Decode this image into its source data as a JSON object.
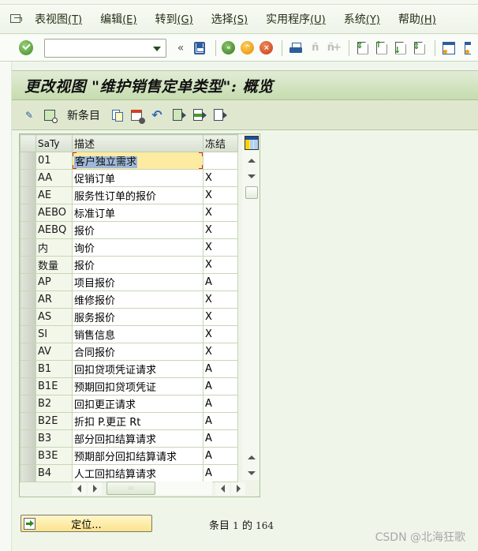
{
  "menubar": {
    "items": [
      {
        "label": "表视图",
        "accel": "(T)"
      },
      {
        "label": "编辑",
        "accel": "(E)"
      },
      {
        "label": "转到",
        "accel": "(G)"
      },
      {
        "label": "选择",
        "accel": "(S)"
      },
      {
        "label": "实用程序",
        "accel": "(U)"
      },
      {
        "label": "系统",
        "accel": "(Y)"
      },
      {
        "label": "帮助",
        "accel": "(H)"
      }
    ]
  },
  "toolbar": {
    "command_field_value": "",
    "history_glyph": "«",
    "icons": [
      "enter-icon",
      "save-icon",
      "back-icon",
      "exit-icon",
      "cancel-icon",
      "print-icon",
      "find-icon",
      "find-next-icon",
      "first-page-icon",
      "previous-page-icon",
      "next-page-icon",
      "last-page-icon",
      "create-session-icon",
      "shortcut-icon"
    ]
  },
  "title": "更改视图 \"维护销售定单类型\": 概览",
  "app_toolbar": {
    "new_entries_label": "新条目",
    "icons": [
      "display-change-icon",
      "details-icon",
      "copy-icon",
      "delete-icon",
      "undo-icon",
      "select-all-icon",
      "select-block-icon",
      "deselect-all-icon"
    ]
  },
  "table": {
    "columns": [
      "SaTy",
      "描述",
      "冻结"
    ],
    "rows": [
      {
        "saty": "01",
        "desc": "客户独立需求",
        "frz": ""
      },
      {
        "saty": "AA",
        "desc": "促销订单",
        "frz": "X"
      },
      {
        "saty": "AE",
        "desc": "服务性订单的报价",
        "frz": "X"
      },
      {
        "saty": "AEBO",
        "desc": "标准订单",
        "frz": "X"
      },
      {
        "saty": "AEBQ",
        "desc": "报价",
        "frz": "X"
      },
      {
        "saty": "内",
        "desc": "询价",
        "frz": "X"
      },
      {
        "saty": "数量",
        "desc": "报价",
        "frz": "X"
      },
      {
        "saty": "AP",
        "desc": "项目报价",
        "frz": "A"
      },
      {
        "saty": "AR",
        "desc": "维修报价",
        "frz": "X"
      },
      {
        "saty": "AS",
        "desc": "服务报价",
        "frz": "X"
      },
      {
        "saty": "SI",
        "desc": "销售信息",
        "frz": "X"
      },
      {
        "saty": "AV",
        "desc": "合同报价",
        "frz": "X"
      },
      {
        "saty": "B1",
        "desc": "回扣贷项凭证请求",
        "frz": "A"
      },
      {
        "saty": "B1E",
        "desc": "预期回扣贷项凭证",
        "frz": "A"
      },
      {
        "saty": "B2",
        "desc": "回扣更正请求",
        "frz": "A"
      },
      {
        "saty": "B2E",
        "desc": "折扣 P.更正 Rt",
        "frz": "A"
      },
      {
        "saty": "B3",
        "desc": "部分回扣结算请求",
        "frz": "A"
      },
      {
        "saty": "B3E",
        "desc": "预期部分回扣结算请求",
        "frz": "A"
      },
      {
        "saty": "B4",
        "desc": "人工回扣结算请求",
        "frz": "A"
      }
    ]
  },
  "footer": {
    "position_button_label": "定位...",
    "entry_prefix": "条目",
    "entry_current": "1",
    "entry_of": "的",
    "entry_total": "164"
  },
  "watermark": "CSDN @北海狂歌"
}
